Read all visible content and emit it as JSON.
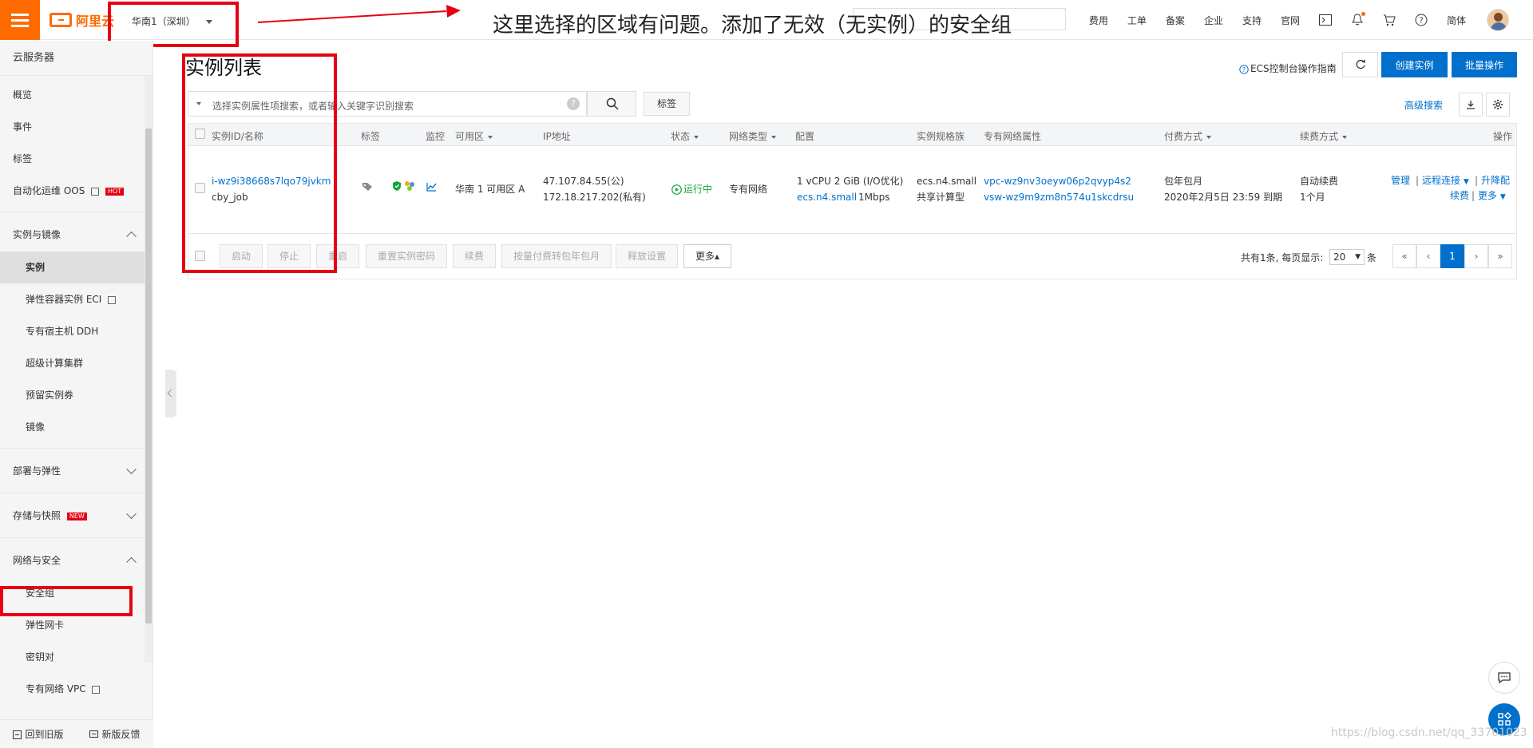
{
  "topbar": {
    "brand": "阿里云",
    "region": "华南1（深圳）",
    "nav": [
      "费用",
      "工单",
      "备案",
      "企业",
      "支持",
      "官网"
    ],
    "lang": "简体"
  },
  "annotation": {
    "text": "这里选择的区域有问题。添加了无效（无实例）的安全组"
  },
  "sidebar": {
    "title": "云服务器",
    "top_items": [
      "概览",
      "事件",
      "标签",
      "自动化运维 OOS"
    ],
    "hot_badge": "HOT",
    "new_badge": "NEW",
    "groups": {
      "instances": {
        "label": "实例与镜像",
        "items": [
          "实例",
          "弹性容器实例 ECI",
          "专有宿主机 DDH",
          "超级计算集群",
          "预留实例券",
          "镜像"
        ]
      },
      "deploy": {
        "label": "部署与弹性"
      },
      "storage": {
        "label": "存储与快照"
      },
      "network": {
        "label": "网络与安全",
        "items": [
          "安全组",
          "弹性网卡",
          "密钥对",
          "专有网络 VPC"
        ]
      }
    },
    "footer": {
      "old": "回到旧版",
      "feedback": "新版反馈"
    }
  },
  "main": {
    "title": "实例列表",
    "guide": "ECS控制台操作指南",
    "create_btn": "创建实例",
    "batch_btn": "批量操作",
    "search_placeholder": "选择实例属性项搜索，或者输入关键字识别搜索",
    "tag_btn": "标签",
    "advanced_search": "高级搜索"
  },
  "table": {
    "headers": {
      "id_name": "实例ID/名称",
      "tags": "标签",
      "monitor": "监控",
      "zone": "可用区",
      "ip": "IP地址",
      "status": "状态",
      "net_type": "网络类型",
      "config": "配置",
      "spec_family": "实例规格族",
      "vpc_attr": "专有网络属性",
      "billing": "付费方式",
      "renew": "续费方式",
      "ops": "操作"
    },
    "row": {
      "id": "i-wz9i38668s7lqo79jvkm",
      "name": "cby_job",
      "zone": "华南 1 可用区 A",
      "ip_public": "47.107.84.55(公)",
      "ip_private": "172.18.217.202(私有)",
      "status": "运行中",
      "net_type": "专有网络",
      "config_line1": "1 vCPU 2 GiB (I/O优化)",
      "config_spec": "ecs.n4.small",
      "config_bw": "1Mbps",
      "spec_family_1": "ecs.n4.small",
      "spec_family_2": "共享计算型",
      "vpc": "vpc-wz9nv3oeyw06p2qvyp4s2",
      "vsw": "vsw-wz9m9zm8n574u1skcdrsu",
      "billing": "包年包月",
      "expire": "2020年2月5日 23:59 到期",
      "renew": "自动续费",
      "renew_period": "1个月",
      "op_manage": "管理",
      "op_remote": "远程连接",
      "op_upgrade": "升降配",
      "op_renew": "续费",
      "op_more": "更多"
    },
    "footer_buttons": [
      "启动",
      "停止",
      "重启",
      "重置实例密码",
      "续费",
      "按量付费转包年包月",
      "释放设置",
      "更多▴"
    ],
    "pager": {
      "info": "共有1条, 每页显示:",
      "per_page": "20",
      "unit": "条",
      "first": "«",
      "prev": "‹",
      "current": "1",
      "next": "›",
      "last": "»"
    }
  },
  "watermark": "https://blog.csdn.net/qq_33701023"
}
